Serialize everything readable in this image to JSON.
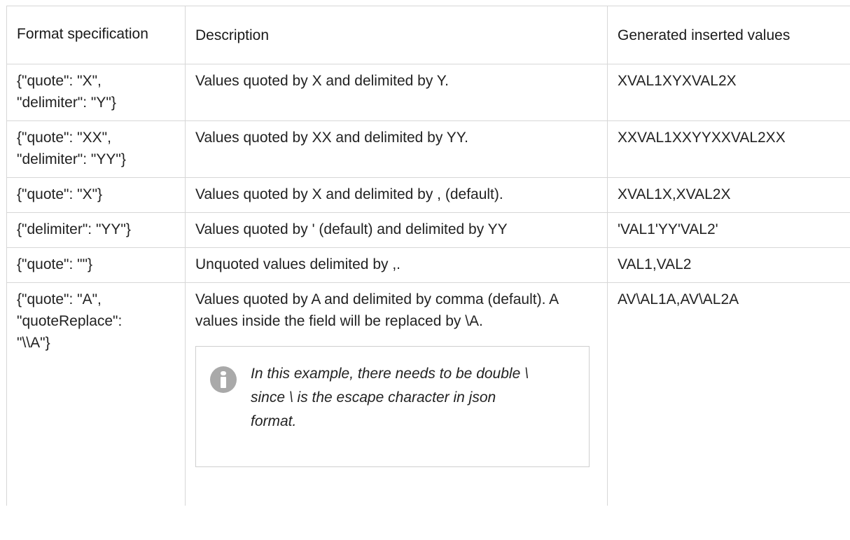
{
  "table": {
    "headers": [
      "Format specification",
      "Description",
      "Generated inserted values"
    ],
    "rows": [
      {
        "format_lines": [
          "{\"quote\": \"X\",",
          "\"delimiter\": \"Y\"}"
        ],
        "description": "Values quoted by X and delimited by Y.",
        "generated": "XVAL1XYXVAL2X"
      },
      {
        "format_lines": [
          "{\"quote\": \"XX\",",
          "\"delimiter\": \"YY\"}"
        ],
        "description": "Values quoted by XX and delimited by YY.",
        "generated": "XXVAL1XXYYXXVAL2XX"
      },
      {
        "format_lines": [
          "{\"quote\": \"X\"}"
        ],
        "description": "Values quoted by X and delimited by , (default).",
        "generated": "XVAL1X,XVAL2X"
      },
      {
        "format_lines": [
          "{\"delimiter\": \"YY\"}"
        ],
        "description": "Values quoted by ' (default) and delimited by YY",
        "generated": "'VAL1'YY'VAL2'"
      },
      {
        "format_lines": [
          "{\"quote\": \"\"}"
        ],
        "description": "Unquoted values delimited by ,.",
        "generated": "VAL1,VAL2"
      },
      {
        "format_lines": [
          "{\"quote\": \"A\",",
          "\"quoteReplace\":",
          "\"\\\\A\"}"
        ],
        "description": "Values quoted by A and delimited by comma (default). A values inside the field will be replaced by \\A.",
        "generated": "AV\\AL1A,AV\\AL2A",
        "note": {
          "icon": "info-icon",
          "text": "In this example, there needs to be double \\ since \\ is the escape character in json format."
        }
      }
    ]
  }
}
